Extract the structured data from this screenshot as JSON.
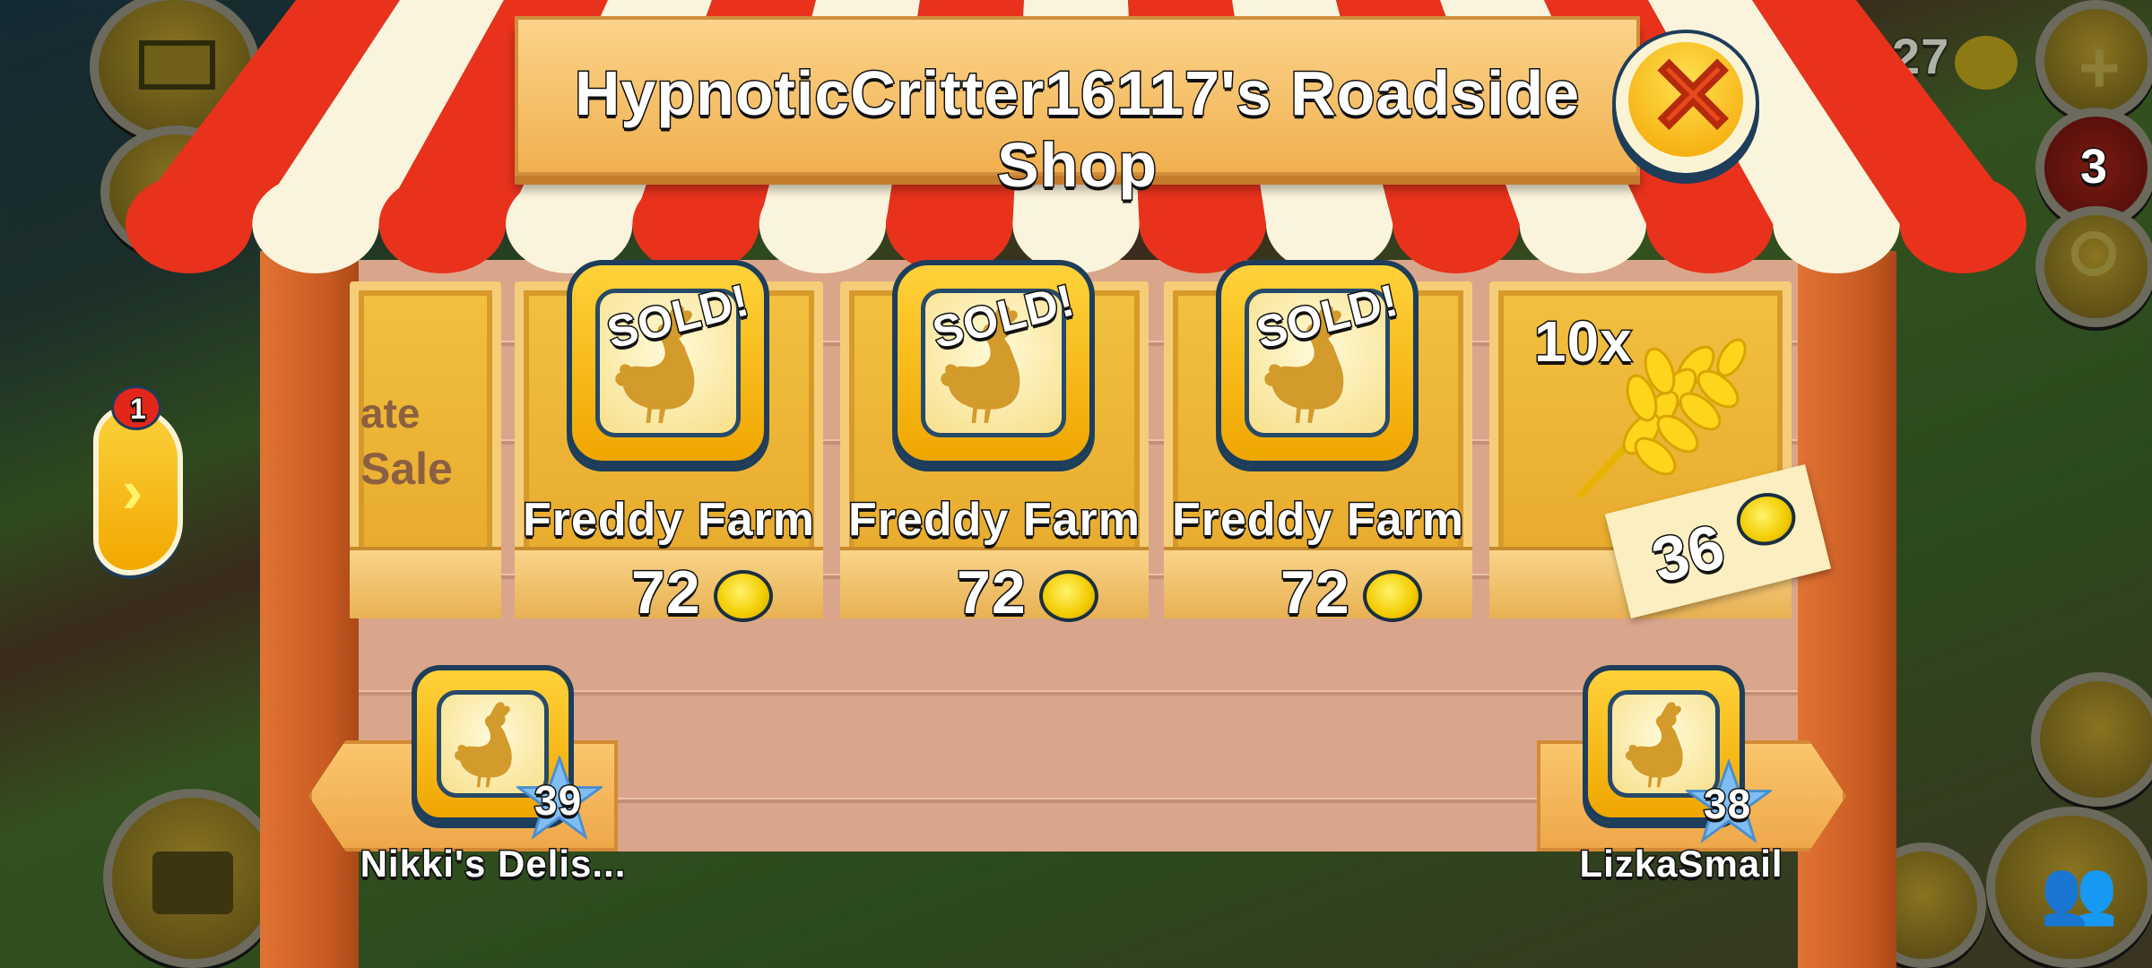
{
  "title": "HypnoticCritter16117's Roadside Shop",
  "close_icon": "close-x-icon",
  "colors": {
    "awning_red": "#e8321c",
    "awning_white": "#fbf4dc",
    "wood": "#f0b53a",
    "wall": "#d9a68b",
    "post": "#d8682a"
  },
  "left_slot": {
    "text_line1": "ate",
    "text_line2": "Sale"
  },
  "slots": [
    {
      "status": "SOLD!",
      "name": "Freddy Farm",
      "price": "72",
      "icon": "chicken-silhouette-icon"
    },
    {
      "status": "SOLD!",
      "name": "Freddy Farm",
      "price": "72",
      "icon": "chicken-silhouette-icon"
    },
    {
      "status": "SOLD!",
      "name": "Freddy Farm",
      "price": "72",
      "icon": "chicken-silhouette-icon"
    }
  ],
  "wheat_slot": {
    "quantity": "10x",
    "price": "36",
    "icon": "wheat-icon"
  },
  "prev_shop": {
    "name": "Nikki's Delis...",
    "level": "39"
  },
  "next_shop": {
    "name": "LizkaSmail",
    "level": "38"
  },
  "side_arrow": {
    "badge": "1"
  },
  "hud": {
    "coins_partial": "27",
    "notifications": "3"
  }
}
